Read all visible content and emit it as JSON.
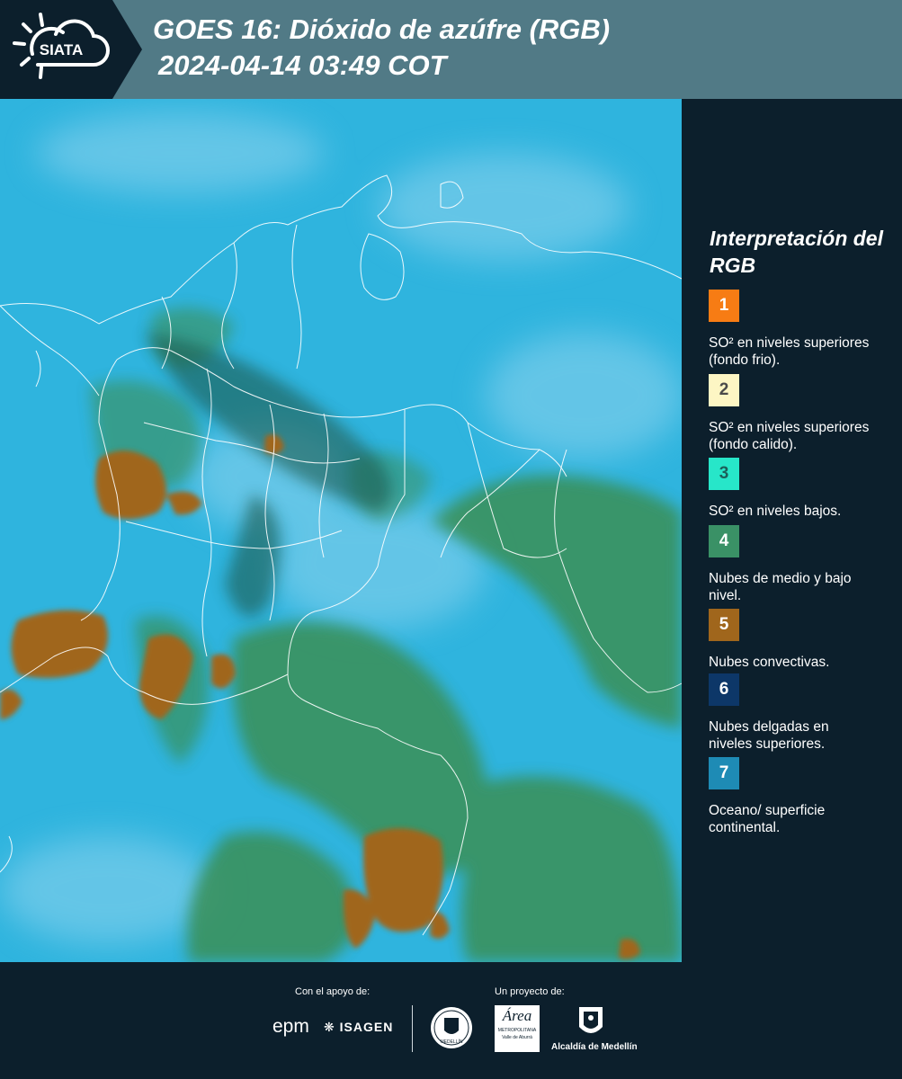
{
  "header": {
    "brand": "SIATA",
    "title_line1": "GOES 16: Dióxido de azúfre (RGB)",
    "title_line2": "2024-04-14 03:49 COT"
  },
  "legend": {
    "title": "Interpretación del RGB",
    "items": [
      {
        "number": "1",
        "text": "SO² en niveles superiores (fondo frio).",
        "color": "#f77c14",
        "number_color": "#ffffff"
      },
      {
        "number": "2",
        "text": "SO² en niveles superiores (fondo calido).",
        "color": "#fdf6c4",
        "number_color": "#4a4a4a"
      },
      {
        "number": "3",
        "text": "SO² en niveles bajos.",
        "color": "#27e6c9",
        "number_color": "#1c5f5a"
      },
      {
        "number": "4",
        "text": "Nubes de medio y bajo nivel.",
        "color": "#3a9166",
        "number_color": "#ffffff"
      },
      {
        "number": "5",
        "text": "Nubes convectivas.",
        "color": "#a0661c",
        "number_color": "#ffffff"
      },
      {
        "number": "6",
        "text": "Nubes delgadas en niveles superiores.",
        "color": "#0d3768",
        "number_color": "#ffffff"
      },
      {
        "number": "7",
        "text": "Oceano/ superficie continental.",
        "color": "#1e8bb5",
        "number_color": "#ffffff"
      }
    ]
  },
  "footer": {
    "support_label": "Con el apoyo de:",
    "project_label": "Un proyecto de:",
    "sponsor_epm": "epm",
    "sponsor_isagen": "ISAGEN",
    "partner_area_line1": "Área",
    "partner_area_line2": "METROPOLITANA",
    "partner_area_line3": "Valle de Aburrá",
    "partner_alcaldia": "Alcaldía de Medellín",
    "seal_text": "MEDELLÍN"
  },
  "map": {
    "colors": {
      "ocean": "#2fb4de",
      "land_green": "#3a8f55",
      "convective": "#a0661c",
      "border": "#ffffff"
    }
  }
}
